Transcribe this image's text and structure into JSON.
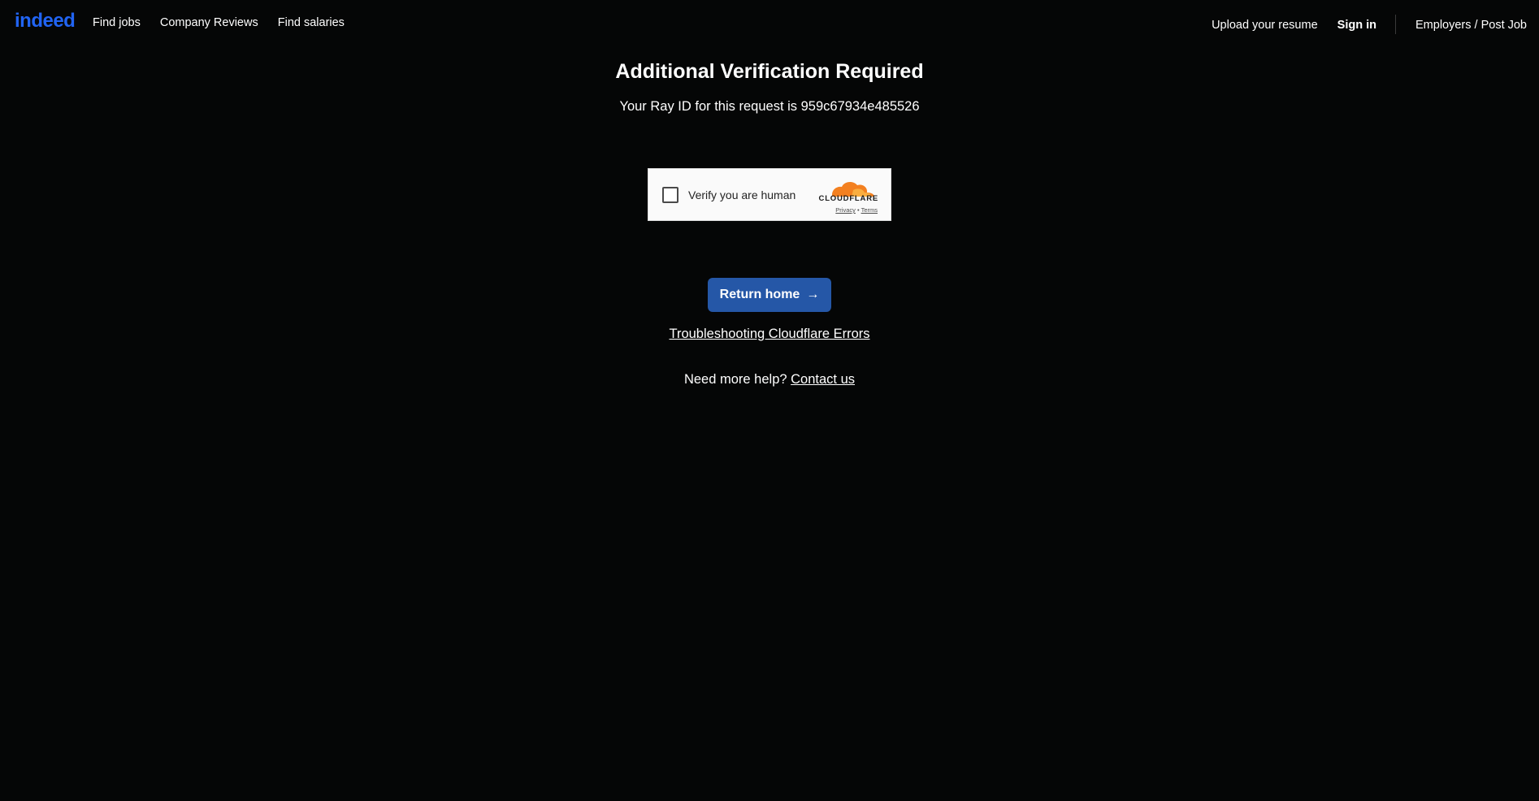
{
  "header": {
    "logo_text": "indeed",
    "nav_left": [
      "Find jobs",
      "Company Reviews",
      "Find salaries"
    ],
    "upload_resume": "Upload your resume",
    "sign_in": "Sign in",
    "employers": "Employers / Post Job"
  },
  "main": {
    "title": "Additional Verification Required",
    "ray_prefix": "Your Ray ID for this request is",
    "ray_id": "959c67934e485526",
    "return_home": "Return home",
    "return_arrow": "→",
    "troubleshoot_link": "Troubleshooting Cloudflare Errors",
    "help_text": "Need more help?",
    "contact_link": "Contact us"
  },
  "turnstile": {
    "label": "Verify you are human",
    "brand": "CLOUDFLARE",
    "privacy": "Privacy",
    "separator": "•",
    "terms": "Terms"
  },
  "colors": {
    "background": "#050606",
    "indeed_blue": "#2164f3",
    "button_blue": "#2557a7",
    "cloudflare_orange": "#f38020"
  }
}
